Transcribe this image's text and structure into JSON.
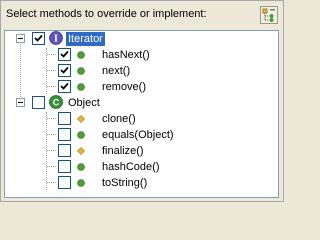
{
  "header": {
    "label": "Select methods to override or implement:",
    "tool_icon": "toggle-tree-icon"
  },
  "tree": {
    "types": [
      {
        "name": "Iterator",
        "kind": "interface",
        "icon": "interface-icon",
        "checked": true,
        "expanded": true,
        "selected": true,
        "methods": [
          {
            "label": "hasNext()",
            "visibility": "public",
            "checked": true
          },
          {
            "label": "next()",
            "visibility": "public",
            "checked": true
          },
          {
            "label": "remove()",
            "visibility": "public",
            "checked": true
          }
        ]
      },
      {
        "name": "Object",
        "kind": "class",
        "icon": "class-icon",
        "checked": false,
        "expanded": true,
        "selected": false,
        "methods": [
          {
            "label": "clone()",
            "visibility": "protected",
            "checked": false
          },
          {
            "label": "equals(Object)",
            "visibility": "public",
            "checked": false
          },
          {
            "label": "finalize()",
            "visibility": "protected",
            "checked": false
          },
          {
            "label": "hashCode()",
            "visibility": "public",
            "checked": false
          },
          {
            "label": "toString()",
            "visibility": "public",
            "checked": false
          }
        ]
      }
    ]
  },
  "colors": {
    "selection": "#316ac5",
    "public_method": "#4c9a3c",
    "protected_method": "#e8b53c",
    "interface": "#5f55b9",
    "class": "#3a8f3a"
  }
}
